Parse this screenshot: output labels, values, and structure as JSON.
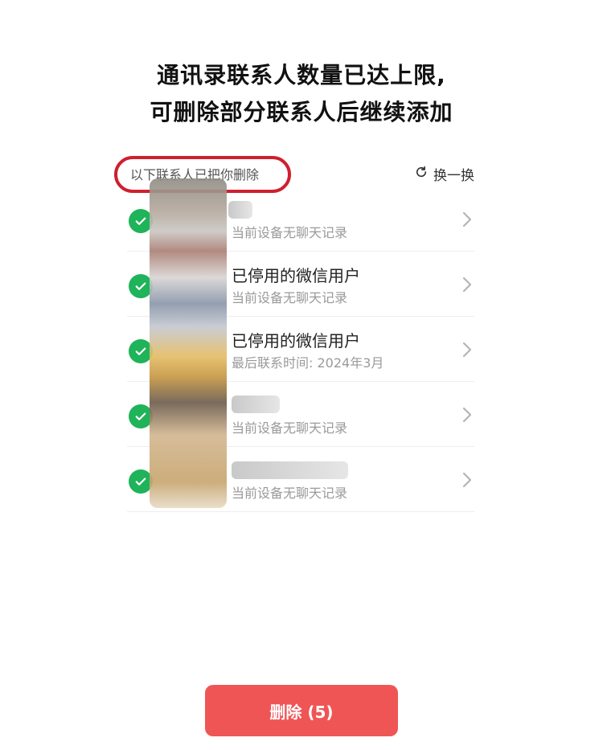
{
  "header": {
    "title_line1": "通讯录联系人数量已达上限,",
    "title_line2": "可删除部分联系人后继续添加"
  },
  "section": {
    "label": "以下联系人已把你删除",
    "refresh_label": "换一换"
  },
  "contacts": [
    {
      "name": "",
      "subtitle": "当前设备无聊天记录",
      "checked": true
    },
    {
      "name": "已停用的微信用户",
      "subtitle": "当前设备无聊天记录",
      "checked": true
    },
    {
      "name": "已停用的微信用户",
      "subtitle": "最后联系时间: 2024年3月",
      "checked": true
    },
    {
      "name": "",
      "subtitle": "当前设备无聊天记录",
      "checked": true
    },
    {
      "name": "",
      "subtitle": "当前设备无聊天记录",
      "checked": true
    }
  ],
  "footer": {
    "delete_label": "删除 (5)"
  },
  "colors": {
    "check": "#1fb35a",
    "delete_button": "#f05555",
    "highlight_ring": "#cf1f2e"
  }
}
